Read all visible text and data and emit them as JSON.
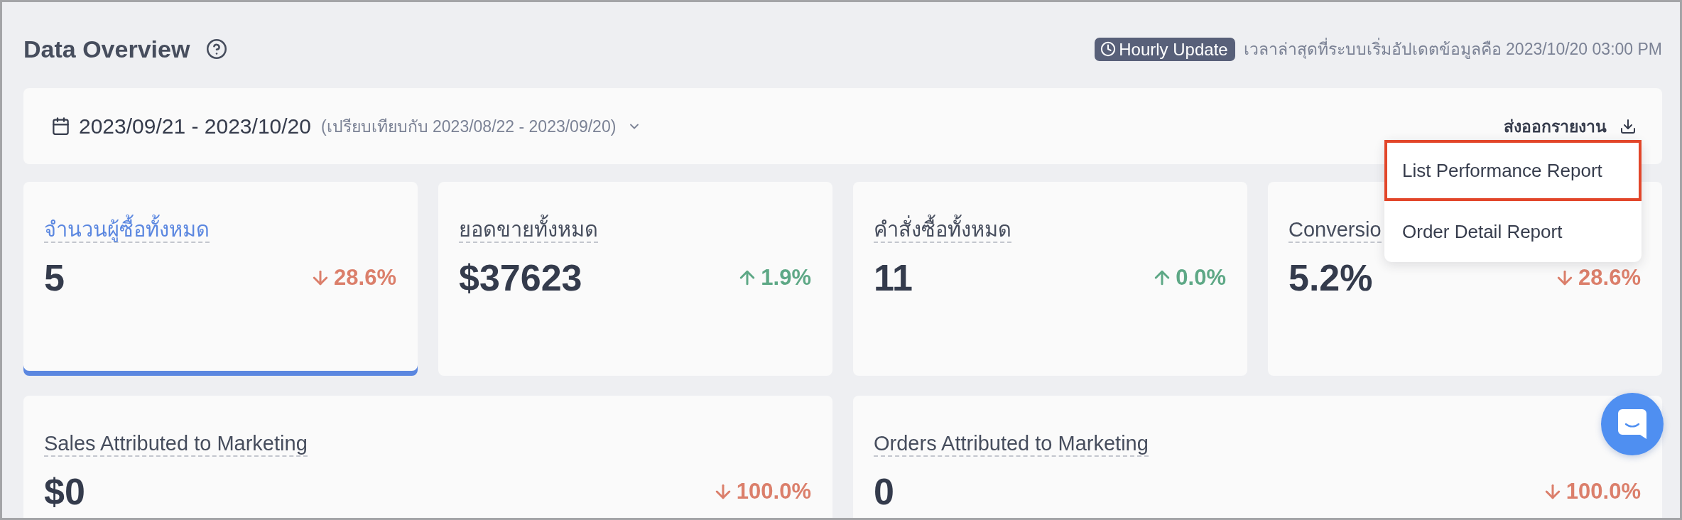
{
  "header": {
    "title": "Data Overview",
    "update_badge": "Hourly Update",
    "last_update": "เวลาล่าสุดที่ระบบเริ่มอัปเดตข้อมูลคือ 2023/10/20 03:00 PM"
  },
  "filter_bar": {
    "date_range": "2023/09/21 - 2023/10/20",
    "compare_range": "(เปรียบเทียบกับ 2023/08/22 - 2023/09/20)",
    "export_label": "ส่งออกรายงาน"
  },
  "export_menu": {
    "items": [
      {
        "label": "List Performance Report",
        "highlighted": true
      },
      {
        "label": "Order Detail Report",
        "highlighted": false
      }
    ]
  },
  "metrics": [
    {
      "kind": "decrease",
      "title": "จำนวนผู้ซื้อทั้งหมด",
      "value": "5",
      "change": "28.6%",
      "selected": true
    },
    {
      "kind": "increase",
      "title": "ยอดขายทั้งหมด",
      "value": "$37623",
      "change": "1.9%",
      "selected": false
    },
    {
      "kind": "increase",
      "title": "คำสั่งซื้อทั้งหมด",
      "value": "11",
      "change": "0.0%",
      "selected": false
    },
    {
      "kind": "decrease",
      "title": "Conversio",
      "value": "5.2%",
      "change": "28.6%",
      "selected": false
    }
  ],
  "marketing_metrics": [
    {
      "kind": "decrease",
      "title": "Sales Attributed to Marketing",
      "value": "$0",
      "change": "100.0%"
    },
    {
      "kind": "decrease",
      "title": "Orders Attributed to Marketing",
      "value": "0",
      "change": "100.0%"
    }
  ]
}
